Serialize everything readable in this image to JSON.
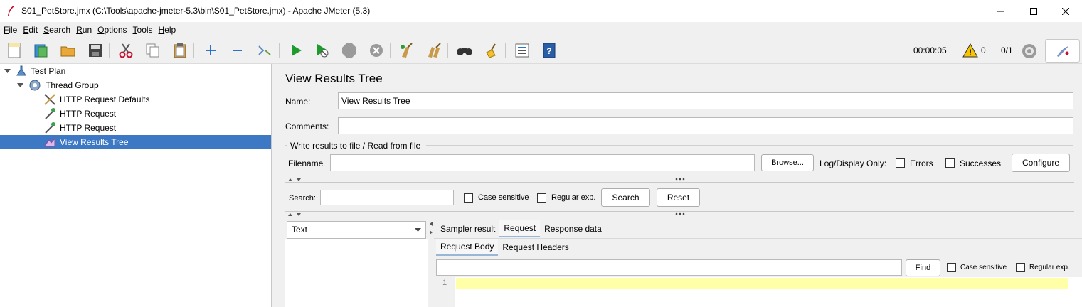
{
  "window": {
    "title": "S01_PetStore.jmx (C:\\Tools\\apache-jmeter-5.3\\bin\\S01_PetStore.jmx) - Apache JMeter (5.3)",
    "controls": [
      "minimize-icon",
      "maximize-icon",
      "close-icon"
    ]
  },
  "menu": [
    {
      "key": "F",
      "rest": "ile"
    },
    {
      "key": "E",
      "rest": "dit"
    },
    {
      "key": "S",
      "rest": "earch"
    },
    {
      "key": "R",
      "rest": "un"
    },
    {
      "key": "O",
      "rest": "ptions"
    },
    {
      "key": "T",
      "rest": "ools"
    },
    {
      "key": "H",
      "rest": "elp"
    }
  ],
  "toolbar": {
    "elapsed": "00:00:05",
    "warnings": "0",
    "threads": "0/1"
  },
  "tree": {
    "items": [
      {
        "label": "Test Plan",
        "icon": "test-plan-icon"
      },
      {
        "label": "Thread Group",
        "icon": "thread-group-gear-icon"
      },
      {
        "label": "HTTP Request Defaults",
        "icon": "tools-icon"
      },
      {
        "label": "HTTP Request",
        "icon": "pipette-icon"
      },
      {
        "label": "HTTP Request",
        "icon": "pipette-icon"
      },
      {
        "label": "View Results Tree",
        "icon": "listener-icon"
      }
    ]
  },
  "panel": {
    "title": "View Results Tree",
    "name_label": "Name:",
    "name_value": "View Results Tree",
    "comments_label": "Comments:",
    "comments_value": "",
    "file_group_title": "Write results to file / Read from file",
    "filename_label": "Filename",
    "filename_value": "",
    "browse": "Browse...",
    "log_display_only": "Log/Display Only:",
    "errors": "Errors",
    "successes": "Successes",
    "configure": "Configure",
    "search_label": "Search:",
    "search_value": "",
    "case_sensitive": "Case sensitive",
    "regular_exp": "Regular exp.",
    "search_button": "Search",
    "reset_button": "Reset",
    "renderer_selected": "Text",
    "result_tabs": [
      "Sampler result",
      "Request",
      "Response data"
    ],
    "request_tabs": [
      "Request Body",
      "Request Headers"
    ],
    "find_value": "",
    "find_button": "Find",
    "editor_line_number": "1"
  }
}
